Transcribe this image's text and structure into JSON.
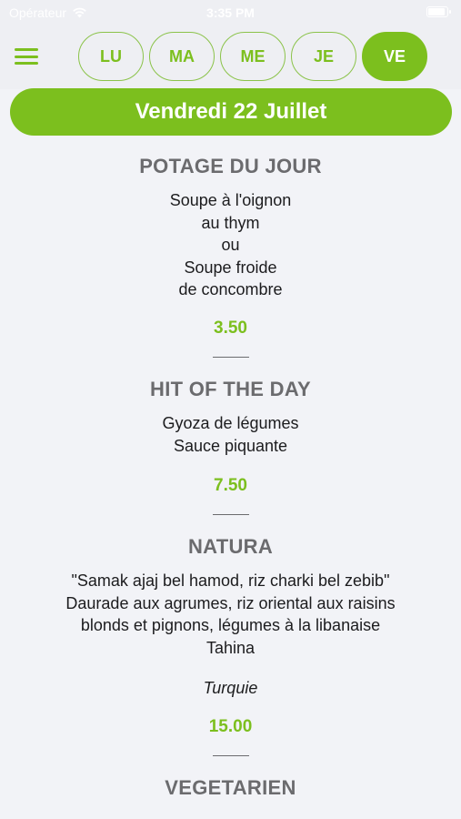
{
  "status_bar": {
    "carrier": "Opérateur",
    "time": "3:35 PM"
  },
  "nav": {
    "days": [
      {
        "label": "LU",
        "active": false
      },
      {
        "label": "MA",
        "active": false
      },
      {
        "label": "ME",
        "active": false
      },
      {
        "label": "JE",
        "active": false
      },
      {
        "label": "VE",
        "active": true
      }
    ]
  },
  "date_banner": "Vendredi 22 Juillet",
  "menu": [
    {
      "title": "POTAGE DU JOUR",
      "lines": [
        "Soupe à l'oignon",
        "au thym",
        "ou",
        "Soupe froide",
        "de concombre"
      ],
      "origin": "",
      "price": "3.50"
    },
    {
      "title": "HIT OF THE DAY",
      "lines": [
        "Gyoza de légumes",
        "Sauce piquante"
      ],
      "origin": "",
      "price": "7.50"
    },
    {
      "title": "NATURA",
      "lines": [
        "\"Samak ajaj bel hamod, riz charki bel zebib\"",
        "Daurade aux agrumes, riz oriental aux raisins",
        "blonds et pignons, légumes à la libanaise",
        "Tahina"
      ],
      "origin": "Turquie",
      "price": "15.00"
    },
    {
      "title": "VEGETARIEN",
      "lines": [],
      "origin": "",
      "price": ""
    }
  ],
  "colors": {
    "accent": "#7cbf1e",
    "title_gray": "#6b6b6e",
    "background": "#f2f3f7"
  }
}
